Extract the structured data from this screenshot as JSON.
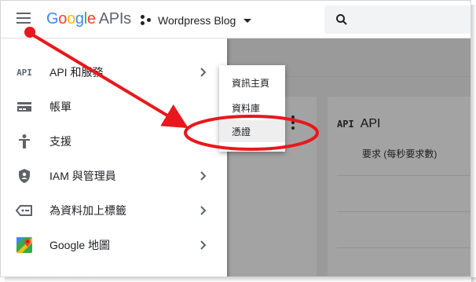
{
  "header": {
    "logo": {
      "G": "G",
      "o1": "o",
      "o2": "o",
      "g": "g",
      "l": "l",
      "e": "e",
      "apis": "APIs"
    },
    "project_name": "Wordpress Blog",
    "icons": {
      "menu": "hamburger-menu-icon",
      "project": "project-dots-icon",
      "dropdown": "caret-down-icon",
      "search": "search-icon"
    }
  },
  "sidenav": {
    "items": [
      {
        "label": "API 和服務",
        "icon": "api-icon",
        "has_submenu": true
      },
      {
        "label": "帳單",
        "icon": "billing-card-icon",
        "has_submenu": false
      },
      {
        "label": "支援",
        "icon": "support-person-icon",
        "has_submenu": false
      },
      {
        "label": "IAM 與管理員",
        "icon": "shield-icon",
        "has_submenu": true
      },
      {
        "label": "為資料加上標籤",
        "icon": "label-tag-icon",
        "has_submenu": true
      },
      {
        "label": "Google 地圖",
        "icon": "maps-pin-icon",
        "has_submenu": true
      }
    ],
    "api_badge": "API"
  },
  "submenu": {
    "items": [
      {
        "label": "資訊主頁"
      },
      {
        "label": "資料庫"
      },
      {
        "label": "憑證",
        "highlighted": true
      }
    ]
  },
  "background": {
    "api_card": {
      "badge": "API",
      "title": "API",
      "subtitle": "要求 (每秒要求數)"
    }
  },
  "colors": {
    "google_blue": "#4285f4",
    "google_red": "#ea4335",
    "google_yellow": "#fbbc05",
    "google_green": "#34a853",
    "annotation_red": "#e8181c",
    "overlay": "rgba(0,0,0,0.36)"
  }
}
